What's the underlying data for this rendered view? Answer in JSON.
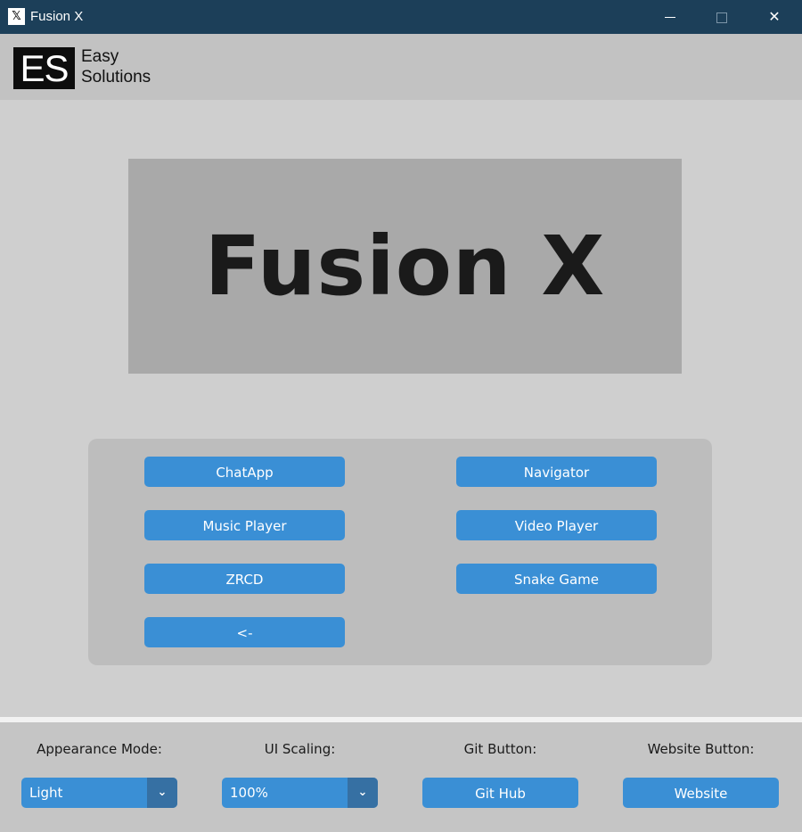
{
  "window": {
    "icon": "fusion-x-app-icon",
    "icon_glyph": "𝕏",
    "title": "Fusion X",
    "minimize": "minimize-icon",
    "maximize": "maximize-icon",
    "close_glyph": "✕"
  },
  "logo": {
    "mark": "ES",
    "line1": "Easy",
    "line2": "Solutions"
  },
  "banner": {
    "title": "Fusion X"
  },
  "apps": {
    "chatapp": "ChatApp",
    "navigator": "Navigator",
    "music_player": "Music Player",
    "video_player": "Video Player",
    "zrcd": "ZRCD",
    "snake_game": "Snake Game",
    "back": "<-"
  },
  "settings": {
    "appearance_label": "Appearance Mode:",
    "appearance_value": "Light",
    "scaling_label": "UI Scaling:",
    "scaling_value": "100%",
    "git_label": "Git Button:",
    "git_button": "Git Hub",
    "website_label": "Website Button:",
    "website_button": "Website",
    "dropdown_arrow": "⌄"
  },
  "colors": {
    "titlebar": "#1c3f59",
    "accent": "#3a8fd5",
    "accent_dark": "#3670a3",
    "background": "#cfcfcf",
    "panel": "#bdbdbd"
  }
}
